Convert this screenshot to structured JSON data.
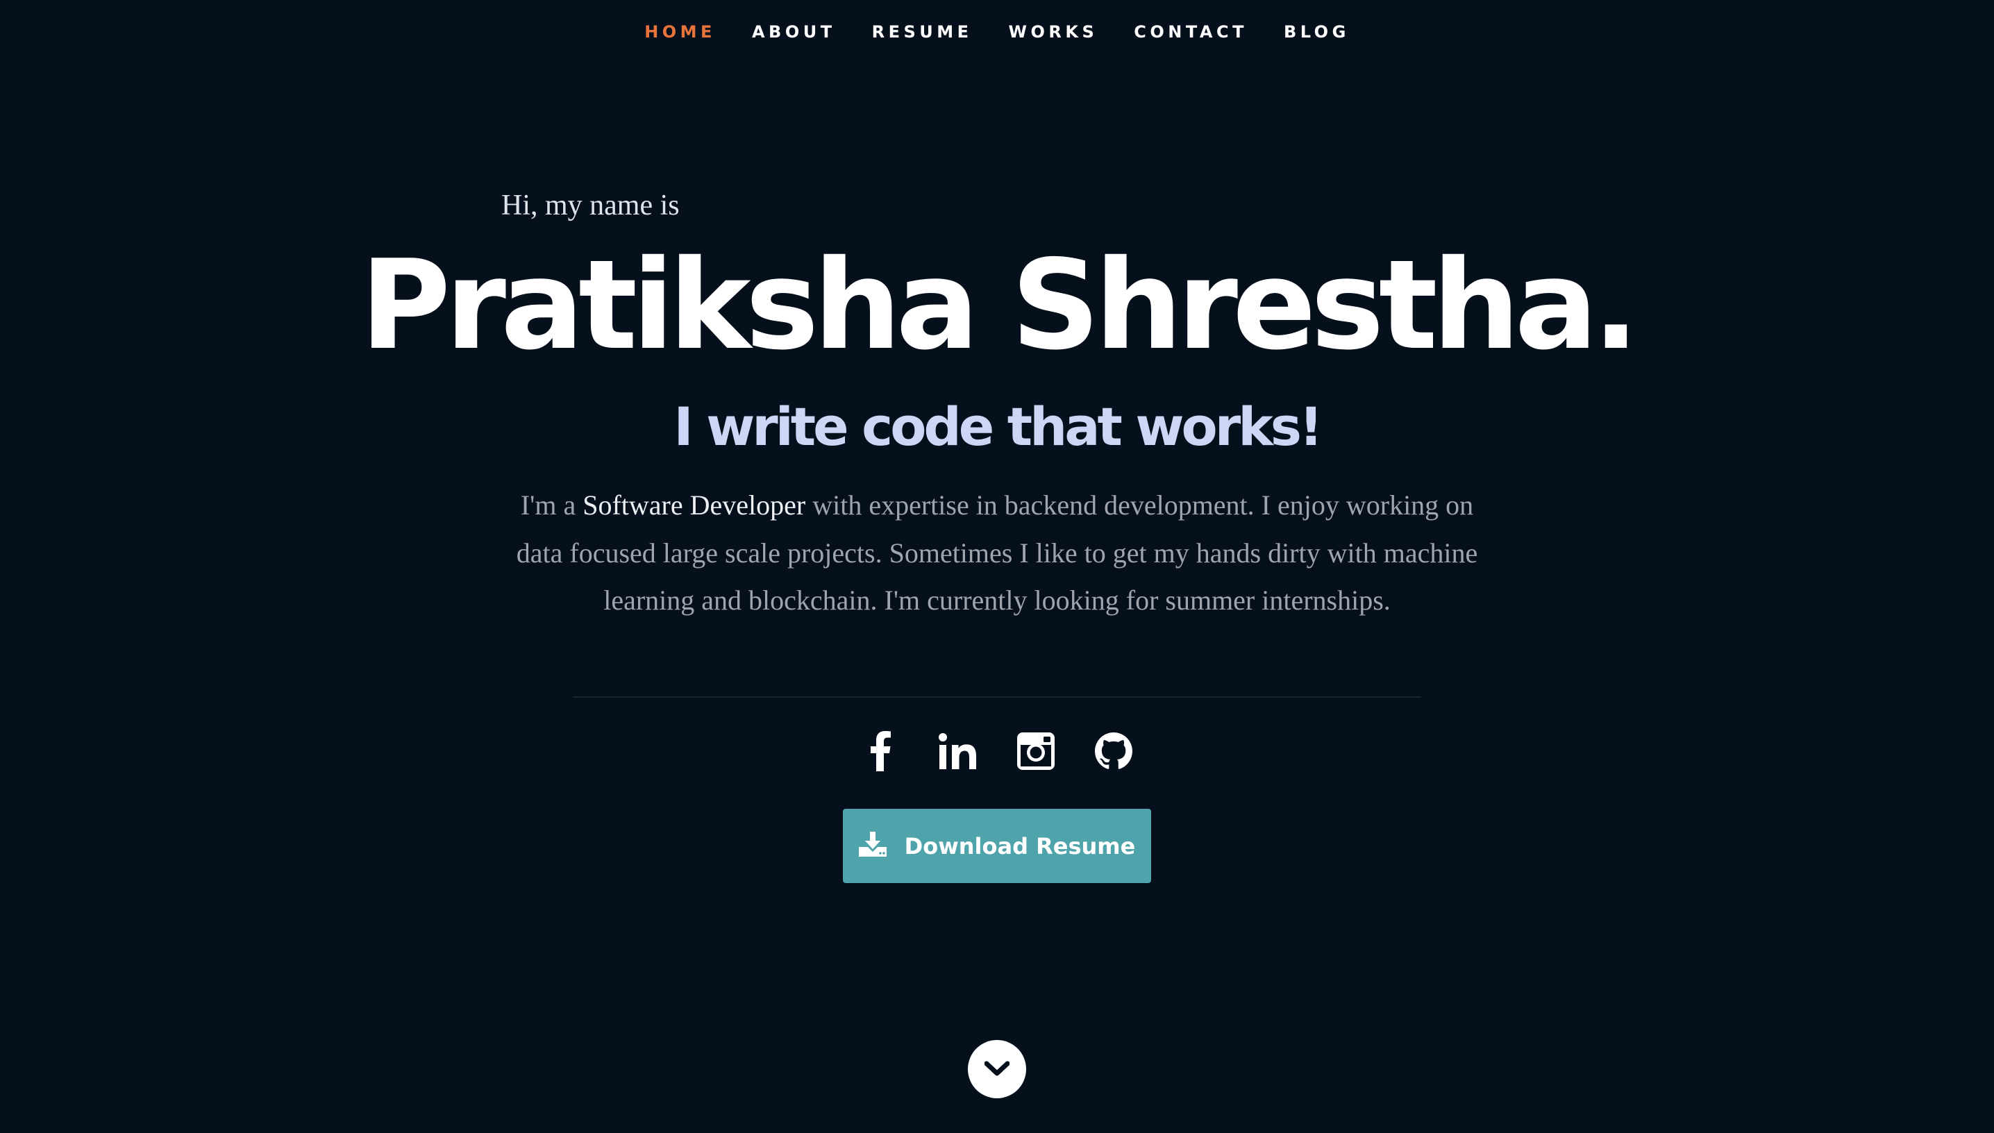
{
  "nav": {
    "items": [
      {
        "label": "HOME",
        "active": true
      },
      {
        "label": "ABOUT"
      },
      {
        "label": "RESUME"
      },
      {
        "label": "WORKS"
      },
      {
        "label": "CONTACT"
      },
      {
        "label": "BLOG"
      }
    ]
  },
  "hero": {
    "greeting": "Hi, my name is",
    "name": "Pratiksha Shrestha.",
    "tagline": "I write code that works!",
    "bio": {
      "prefix": "I'm a",
      "highlight": "Software Developer",
      "rest": "with expertise in backend development. I enjoy working on data focused large scale projects. Sometimes I like to get my hands dirty with machine learning and blockchain. I'm currently looking for summer internships."
    }
  },
  "socials": [
    {
      "icon": "facebook-icon"
    },
    {
      "icon": "linkedin-icon"
    },
    {
      "icon": "instagram-icon"
    },
    {
      "icon": "github-icon"
    }
  ],
  "download": {
    "label": "Download Resume",
    "icon": "download-icon"
  },
  "scroll_down": {
    "icon": "chevron-down-icon"
  },
  "colors": {
    "background": "#06101d",
    "nav_active": "#e8743b",
    "tagline": "#cfd6f5",
    "button": "#4fa3aa"
  }
}
